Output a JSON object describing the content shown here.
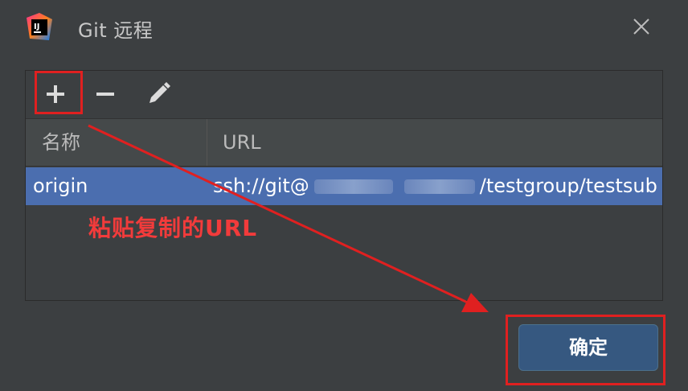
{
  "window": {
    "title": "Git 远程"
  },
  "toolbar": {
    "add_label": "+",
    "remove_label": "−",
    "edit_label": "edit"
  },
  "table": {
    "headers": {
      "name": "名称",
      "url": "URL"
    },
    "rows": [
      {
        "name": "origin",
        "url_prefix": "ssh://git@",
        "url_suffix": "/testgroup/testsub"
      }
    ]
  },
  "annotation": {
    "text": "粘贴复制的URL"
  },
  "dialog": {
    "ok_label": "确定"
  },
  "colors": {
    "background": "#3c3f41",
    "selection": "#4b6eaf",
    "ok_button": "#365880",
    "annotation": "#f23b3b"
  }
}
